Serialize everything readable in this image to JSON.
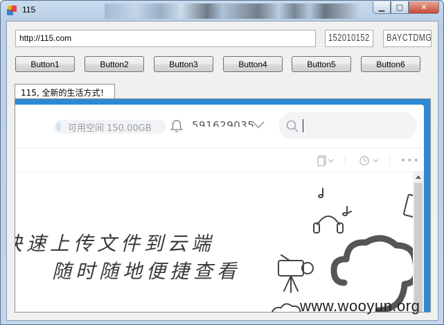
{
  "window": {
    "title": "115",
    "controls": [
      "minimize",
      "maximize",
      "close"
    ]
  },
  "toolbar": {
    "url_value": "http://115.com",
    "field_2_value": "152010152",
    "field_3_value": "BAYCTDMG",
    "buttons": [
      "Button1",
      "Button2",
      "Button3",
      "Button4",
      "Button5",
      "Button6"
    ]
  },
  "tab": {
    "label": "115, 全新的生活方式！"
  },
  "web": {
    "space_label": "可用空间 150.00GB",
    "user_id": "591629035",
    "search_placeholder": "",
    "slogan_line1": "快速上传文件到云端",
    "slogan_line2": "随时随地便捷查看",
    "icons": [
      "bell-icon",
      "chevron-down-icon",
      "search-icon",
      "copy-icon",
      "clock-icon",
      "more-icon"
    ]
  },
  "watermark": "www.wooyun.org",
  "colors": {
    "accent_blue": "#2c8ad4",
    "close_red": "#c74a34"
  }
}
